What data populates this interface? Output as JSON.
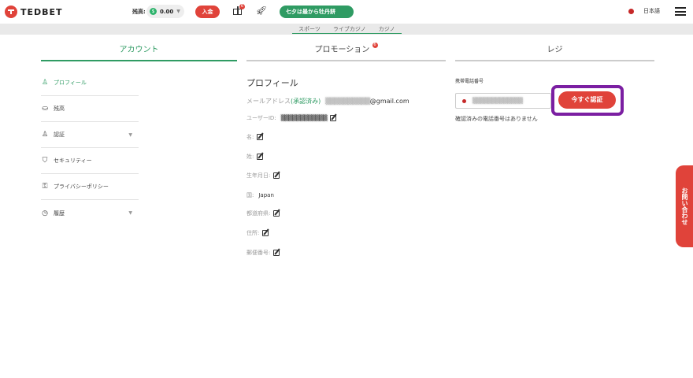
{
  "header": {
    "logo_text": "TEDBET",
    "balance_label": "残高:",
    "balance_currency_icon": "$",
    "balance_value": "0.00",
    "deposit_label": "入金",
    "gift_badge": "6",
    "promo_label": "七夕は最から牡丹餅",
    "language": "日本語"
  },
  "subtabs": [
    "スポーツ",
    "ライブカジノ",
    "カジノ"
  ],
  "main_tabs": {
    "account": "アカウント",
    "promotion": "プロモーション",
    "promotion_badge": "6",
    "cashier": "レジ"
  },
  "sidebar": {
    "items": [
      {
        "label": "プロフィール",
        "icon": "user-icon"
      },
      {
        "label": "残高",
        "icon": "coins-icon"
      },
      {
        "label": "認証",
        "icon": "user-check-icon"
      },
      {
        "label": "セキュリティー",
        "icon": "shield-icon"
      },
      {
        "label": "プライバシーポリシー",
        "icon": "lock-icon"
      },
      {
        "label": "履歴",
        "icon": "clock-icon"
      }
    ]
  },
  "profile": {
    "title": "プロフィール",
    "email_label": "メールアドレス",
    "email_verified": "(承認済み)",
    "email_value": "@gmail.com",
    "userid_label": "ユーザーID:",
    "name_label": "名:",
    "surname_label": "姓:",
    "dob_label": "生年月日:",
    "country_label": "国:",
    "country_value": "Japan",
    "prefecture_label": "都道府県:",
    "address_label": "住所:",
    "postal_label": "郵便番号:"
  },
  "phone": {
    "label": "携帯電話番号",
    "verify_button": "今すぐ認証",
    "note": "確認済みの電話番号はありません"
  },
  "contact_tab": "お問い合わせ",
  "colors": {
    "accent_green": "#2f9b63",
    "brand_red": "#e0433a",
    "highlight_purple": "#7b1fa2"
  }
}
